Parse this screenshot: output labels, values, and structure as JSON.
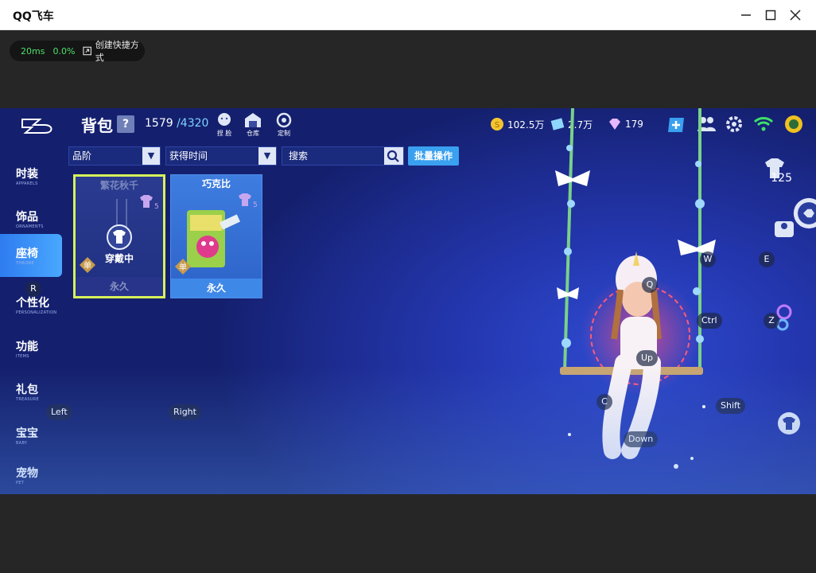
{
  "window": {
    "title": "QQ飞车",
    "minimize_label": "minimize",
    "maximize_label": "maximize",
    "close_label": "close"
  },
  "perf": {
    "ping": "20ms",
    "loss": "0.0%",
    "shortcut_label": "创建快捷方式"
  },
  "header": {
    "title": "背包",
    "help": "?",
    "capacity_used": "1579",
    "capacity_max": "/4320",
    "quick": [
      {
        "label": "捏 脸",
        "icon": "face-icon"
      },
      {
        "label": "仓库",
        "icon": "warehouse-icon"
      },
      {
        "label": "定制",
        "icon": "custom-icon"
      }
    ]
  },
  "currency": {
    "coins": "102.5万",
    "tickets": "2.7万",
    "diamonds": "179"
  },
  "sidebar": {
    "items": [
      {
        "cn": "时装",
        "en": "APPARELS"
      },
      {
        "cn": "饰品",
        "en": "ORNAMENTS"
      },
      {
        "cn": "座椅",
        "en": "THRONE"
      },
      {
        "cn": "个性化",
        "en": "PERSONALIZATION"
      },
      {
        "cn": "功能",
        "en": "ITEMS"
      },
      {
        "cn": "礼包",
        "en": "TREASURE"
      },
      {
        "cn": "宝宝",
        "en": "BABY"
      },
      {
        "cn": "宠物",
        "en": "PET"
      }
    ],
    "active_index": 2
  },
  "filters": {
    "grade": "品阶",
    "sort": "获得时间",
    "search_placeholder": "搜索",
    "batch": "批量操作"
  },
  "items": [
    {
      "name": "繁花秋千",
      "level": "5",
      "duration": "永久",
      "status": "穿戴中",
      "tag": "单"
    },
    {
      "name": "巧克比",
      "level": "5",
      "duration": "永久",
      "tag": "单"
    }
  ],
  "wardrobe_level": "125",
  "keyhints": {
    "r": "R",
    "left": "Left",
    "right": "Right",
    "w": "W",
    "e": "E",
    "q": "Q",
    "ctrl": "Ctrl",
    "z": "Z",
    "up": "Up",
    "c": "C",
    "shift": "Shift",
    "down": "Down"
  },
  "colors": {
    "accent": "#3aa0f0",
    "selected_border": "#d6f25a",
    "background": "#1c2a8c"
  }
}
